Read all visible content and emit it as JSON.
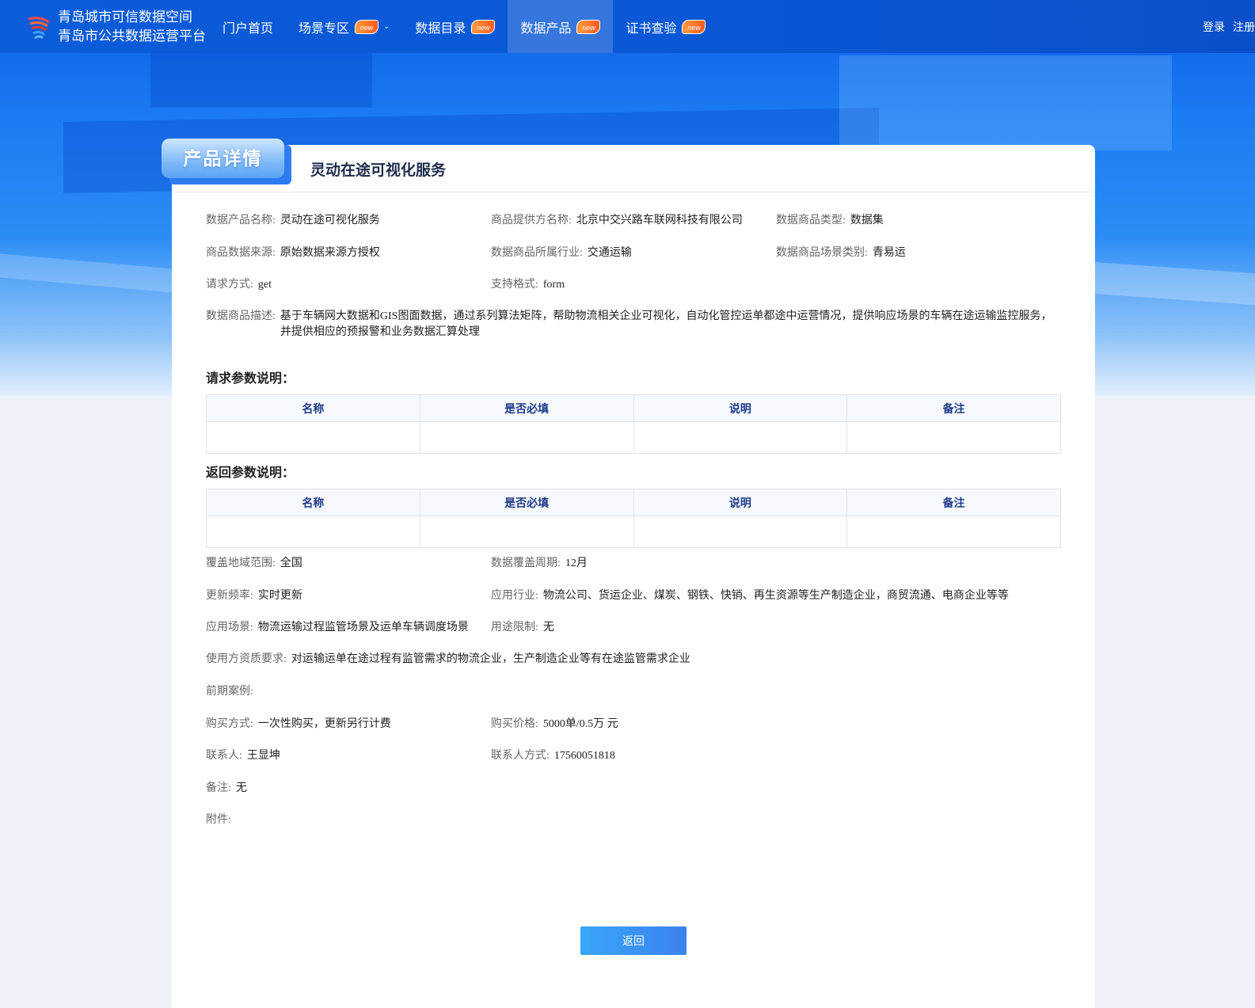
{
  "brand": {
    "line1": "青岛城市可信数据空间",
    "line2": "青岛市公共数据运营平台"
  },
  "nav": {
    "items": [
      {
        "label": "门户首页",
        "badge": ""
      },
      {
        "label": "场景专区",
        "badge": "new"
      },
      {
        "label": "数据目录",
        "badge": "new"
      },
      {
        "label": "数据产品",
        "badge": "new"
      },
      {
        "label": "证书查验",
        "badge": "new"
      }
    ],
    "active": "数据产品"
  },
  "auth": {
    "login": "登录",
    "register": "注册"
  },
  "page": {
    "tab_label": "产品详情",
    "product_title": "灵动在途可视化服务"
  },
  "details": {
    "name_label": "数据产品名称:",
    "name": "灵动在途可视化服务",
    "provider_label": "商品提供方名称:",
    "provider": "北京中交兴路车联网科技有限公司",
    "type_label": "数据商品类型:",
    "type": "数据集",
    "source_label": "商品数据来源:",
    "source": "原始数据来源方授权",
    "industry_label": "数据商品所属行业:",
    "industry": "交通运输",
    "scene_label": "数据商品场景类别:",
    "scene": "青易运",
    "method_label": "请求方式:",
    "method": "get",
    "format_label": "支持格式:",
    "format": "form",
    "desc_label": "数据商品描述:",
    "desc": "基于车辆网大数据和GIS图面数据，通过系列算法矩阵，帮助物流相关企业可视化，自动化管控运单都途中运营情况，提供响应场景的车辆在途运输监控服务，并提供相应的预报警和业务数据汇算处理"
  },
  "request_params": {
    "title": "请求参数说明：",
    "headers": [
      "名称",
      "是否必填",
      "说明",
      "备注"
    ]
  },
  "response_params": {
    "title": "返回参数说明：",
    "headers": [
      "名称",
      "是否必填",
      "说明",
      "备注"
    ]
  },
  "extra": {
    "region_label": "覆盖地域范围:",
    "region": "全国",
    "period_label": "数据覆盖周期:",
    "period": "12月",
    "freq_label": "更新频率:",
    "freq": "实时更新",
    "app_industry_label": "应用行业:",
    "app_industry": "物流公司、货运企业、煤炭、钢铁、快销、再生资源等生产制造企业，商贸流通、电商企业等等",
    "app_scene_label": "应用场景:",
    "app_scene": "物流运输过程监管场景及运单车辆调度场景",
    "limit_label": "用途限制:",
    "limit": "无",
    "qual_label": "使用方资质要求:",
    "qual": "对运输运单在途过程有监管需求的物流企业，生产制造企业等有在途监管需求企业",
    "case_label": "前期案例:",
    "case": "",
    "buy_label": "购买方式:",
    "buy": "一次性购买，更新另行计费",
    "price_label": "购买价格:",
    "price": "5000单/0.5万 元",
    "contact_label": "联系人:",
    "contact": "王显坤",
    "phone_label": "联系人方式:",
    "phone": "17560051818",
    "note_label": "备注:",
    "note": "无",
    "attach_label": "附件:",
    "attach": ""
  },
  "buttons": {
    "back": "返回"
  }
}
